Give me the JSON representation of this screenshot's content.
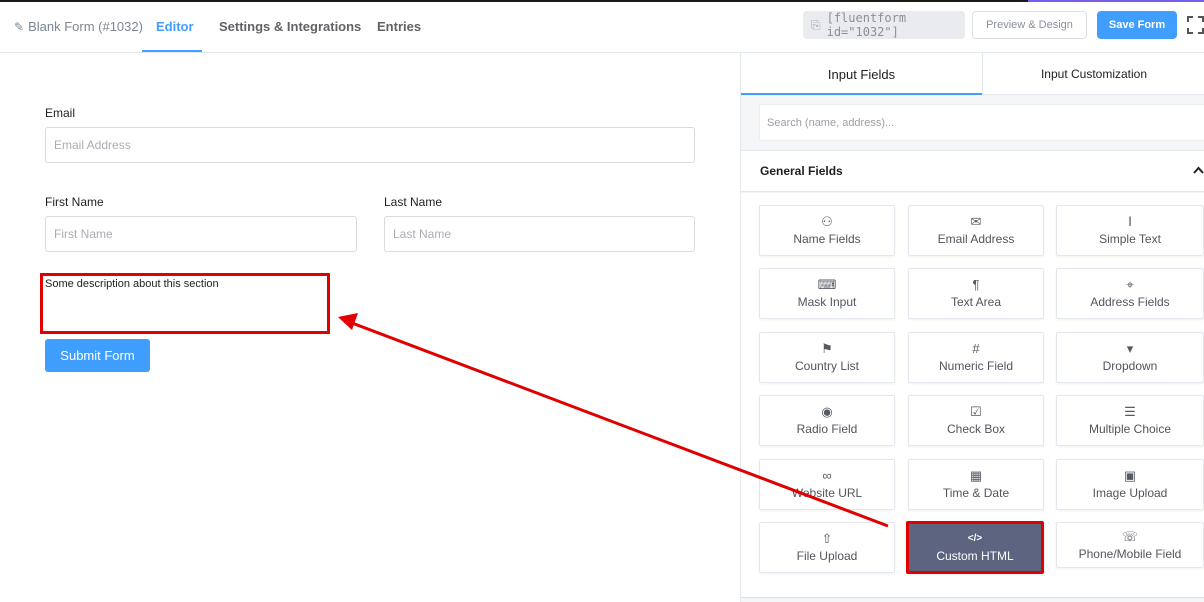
{
  "header": {
    "form_title": "Blank Form (#1032)",
    "tabs": [
      "Editor",
      "Settings & Integrations",
      "Entries"
    ],
    "shortcode": "[fluentform id=\"1032\"]",
    "preview_label": "Preview & Design",
    "save_label": "Save Form"
  },
  "form": {
    "email_label": "Email",
    "email_placeholder": "Email Address",
    "first_name_label": "First Name",
    "first_name_placeholder": "First Name",
    "last_name_label": "Last Name",
    "last_name_placeholder": "Last Name",
    "description": "Some description about this section",
    "submit_label": "Submit Form"
  },
  "sidebar": {
    "tabs": [
      "Input Fields",
      "Input Customization"
    ],
    "search_placeholder": "Search (name, address)...",
    "section_title": "General Fields",
    "fields": [
      {
        "label": "Name Fields",
        "icon": "user-icon"
      },
      {
        "label": "Email Address",
        "icon": "envelope-icon"
      },
      {
        "label": "Simple Text",
        "icon": "text-cursor-icon"
      },
      {
        "label": "Mask Input",
        "icon": "keyboard-icon"
      },
      {
        "label": "Text Area",
        "icon": "paragraph-icon"
      },
      {
        "label": "Address Fields",
        "icon": "location-pin-icon"
      },
      {
        "label": "Country List",
        "icon": "flag-icon"
      },
      {
        "label": "Numeric Field",
        "icon": "hash-icon"
      },
      {
        "label": "Dropdown",
        "icon": "dropdown-icon"
      },
      {
        "label": "Radio Field",
        "icon": "radio-icon"
      },
      {
        "label": "Check Box",
        "icon": "checkbox-icon"
      },
      {
        "label": "Multiple Choice",
        "icon": "list-icon"
      },
      {
        "label": "Website URL",
        "icon": "link-icon"
      },
      {
        "label": "Time & Date",
        "icon": "calendar-icon"
      },
      {
        "label": "Image Upload",
        "icon": "image-icon"
      },
      {
        "label": "File Upload",
        "icon": "upload-icon"
      },
      {
        "label": "Custom HTML",
        "icon": "code-icon"
      },
      {
        "label": "Phone/Mobile Field",
        "icon": "phone-icon"
      }
    ]
  },
  "colors": {
    "accent": "#409eff",
    "highlight": "#e00000",
    "selected_card": "#5c6480"
  }
}
